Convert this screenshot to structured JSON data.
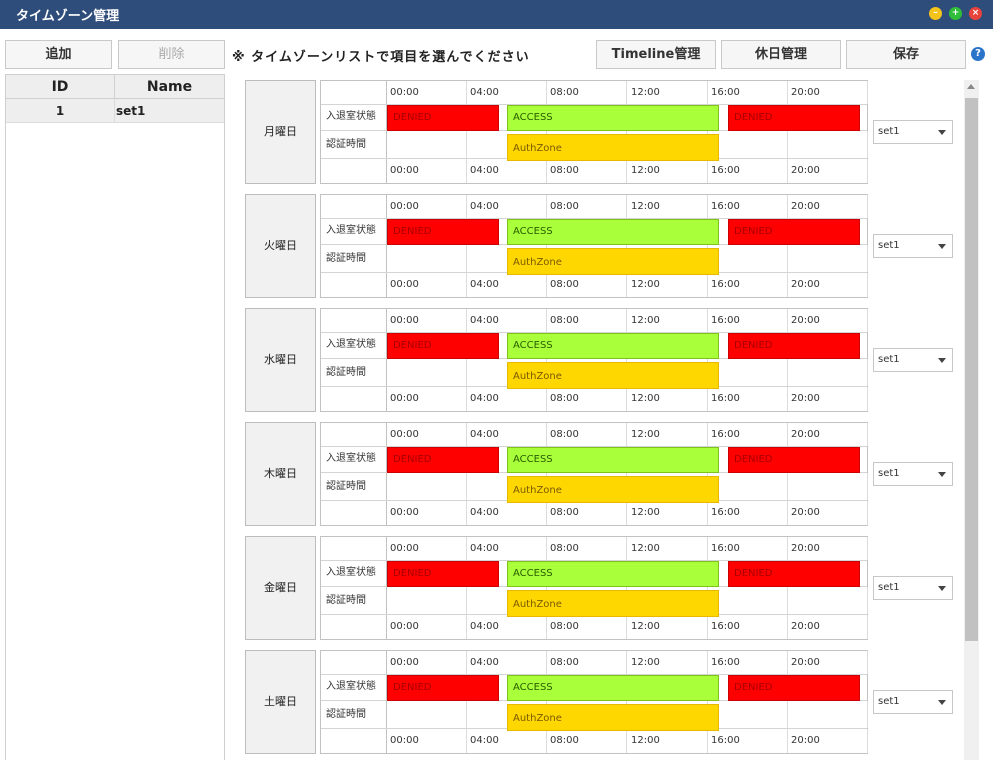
{
  "window": {
    "title": "タイムゾーン管理"
  },
  "toolbar": {
    "add_label": "追加",
    "delete_label": "削除",
    "hint": "※ タイムゾーンリストで項目を選んでください",
    "timeline_label": "Timeline管理",
    "holiday_label": "休日管理",
    "save_label": "保存"
  },
  "list": {
    "headers": {
      "id": "ID",
      "name": "Name"
    },
    "rows": [
      {
        "id": "1",
        "name": "set1"
      }
    ]
  },
  "timeline_labels": {
    "hours": [
      "00:00",
      "04:00",
      "08:00",
      "12:00",
      "16:00",
      "20:00"
    ],
    "status_row": "入退室状態",
    "auth_row": "認証時間",
    "denied": "DENIED",
    "access": "ACCESS",
    "auth_zone": "AuthZone"
  },
  "days": [
    {
      "name": "月曜日",
      "set": "set1"
    },
    {
      "name": "火曜日",
      "set": "set1"
    },
    {
      "name": "水曜日",
      "set": "set1"
    },
    {
      "name": "木曜日",
      "set": "set1"
    },
    {
      "name": "金曜日",
      "set": "set1"
    },
    {
      "name": "土曜日",
      "set": "set1"
    }
  ],
  "colors": {
    "titlebar": "#2f4d7a",
    "denied": "#ff0000",
    "access": "#a8ff3a",
    "auth_zone": "#ffd700"
  }
}
